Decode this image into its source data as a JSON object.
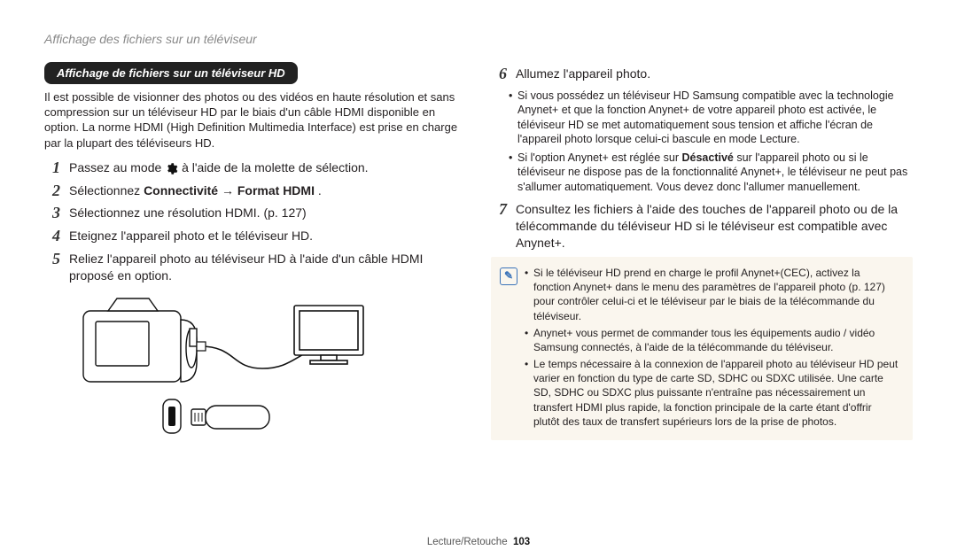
{
  "header": "Affichage des fichiers sur un téléviseur",
  "left": {
    "pill": "Affichage de fichiers sur un téléviseur HD",
    "intro": "Il est possible de visionner des photos ou des vidéos en haute résolution et sans compression sur un téléviseur HD par le biais d'un câble HDMI disponible en option. La norme HDMI (High Definition Multimedia Interface) est prise en charge par la plupart des téléviseurs HD.",
    "steps": {
      "s1_pre": "Passez au mode ",
      "s1_post": " à l'aide de la molette de sélection.",
      "s2_pre": "Sélectionnez ",
      "s2_bold1": "Connectivité",
      "s2_arrow": " → ",
      "s2_bold2": "Format HDMI",
      "s2_post": ".",
      "s3": "Sélectionnez une résolution HDMI. (p. 127)",
      "s4": "Eteignez l'appareil photo et le téléviseur HD.",
      "s5": "Reliez l'appareil photo au téléviseur HD à l'aide d'un câble HDMI proposé en option."
    }
  },
  "right": {
    "s6": "Allumez l'appareil photo.",
    "s6_sub1": "Si vous possédez un téléviseur HD Samsung compatible avec la technologie Anynet+ et que la fonction Anynet+ de votre appareil photo est activée, le téléviseur HD se met automatiquement sous tension et affiche l'écran de l'appareil photo lorsque celui-ci bascule en mode Lecture.",
    "s6_sub2_pre": "Si l'option Anynet+ est réglée sur ",
    "s6_sub2_bold": "Désactivé",
    "s6_sub2_post": " sur l'appareil photo ou si le téléviseur ne dispose pas de la fonctionnalité Anynet+, le téléviseur ne peut pas s'allumer automatiquement. Vous devez donc l'allumer manuellement.",
    "s7": "Consultez les fichiers à l'aide des touches de l'appareil photo ou de la télécommande du téléviseur HD si le téléviseur est compatible avec Anynet+.",
    "notes": {
      "n1": "Si le téléviseur HD prend en charge le profil Anynet+(CEC), activez la fonction Anynet+ dans le menu des paramètres de l'appareil photo (p. 127) pour contrôler celui-ci et le téléviseur par le biais de la télécommande du téléviseur.",
      "n2": "Anynet+ vous permet de commander tous les équipements audio / vidéo Samsung connectés, à l'aide de la télécommande du téléviseur.",
      "n3": "Le temps nécessaire à la connexion de l'appareil photo au téléviseur HD peut varier en fonction du type de carte SD, SDHC ou SDXC utilisée. Une carte SD, SDHC ou SDXC plus puissante n'entraîne pas nécessairement un transfert HDMI plus rapide, la fonction principale de la carte étant d'offrir plutôt des taux de transfert supérieurs lors de la prise de photos."
    }
  },
  "footer": {
    "label": "Lecture/Retouche",
    "page": "103"
  },
  "note_glyph": "✎"
}
